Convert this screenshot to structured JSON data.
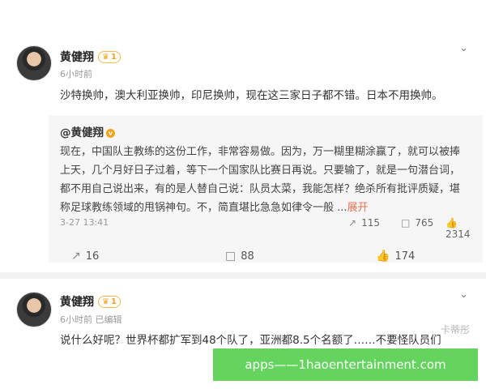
{
  "posts": [
    {
      "author": "黄健翔",
      "vip_label": "1",
      "time": "6小时前",
      "body": "沙特换帅，澳大利亚换帅，印尼换帅，现在这三家日子都不错。日本不用换帅。",
      "repost": {
        "author": "@黄健翔",
        "body_lines": [
          "现在，中国队主教练的这份工作，非常容易做。因为，万一糊里糊涂赢了，就可以被捧",
          "上天，几个月好日子过着，等下一个国家队比赛日再说。只要输了，就是一句潜台词，",
          "都不用自己说出来，有的是人替自己说：队员太菜，我能怎样？绝杀所有批评质疑，堪",
          "称足球教练领域的甩锅神句。不，简直堪比急急如律令一般 ..."
        ],
        "expand": "展开",
        "date": "3-27 13:41",
        "stats": {
          "reposts": "115",
          "comments": "765",
          "likes": "2314"
        }
      },
      "actions": {
        "reposts": "16",
        "comments": "88",
        "likes": "174"
      }
    },
    {
      "author": "黄健翔",
      "vip_label": "1",
      "time": "6小时前",
      "edited": "已编辑",
      "body": "说什么好呢？世界杯都扩军到48个队了，亚洲都8.5个名额了……不要怪队员们"
    }
  ],
  "watermark": "卡蒂彤",
  "banner": "apps——1haoentertainment.com",
  "icons": [
    "chevron-down-icon",
    "crown-icon",
    "repost-icon",
    "comment-icon",
    "like-icon"
  ],
  "colors": {
    "expand_link": "#eb7350",
    "banner_bg": "#65d45f",
    "vip": "#f3a31b"
  }
}
